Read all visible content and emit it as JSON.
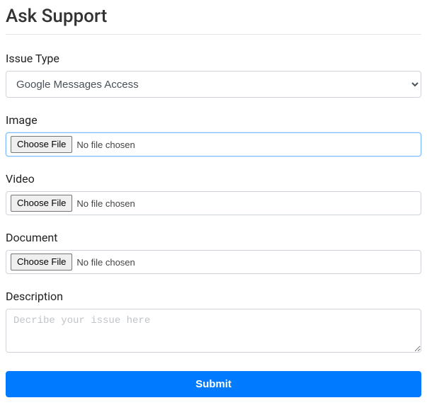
{
  "title": "Ask Support",
  "fields": {
    "issueType": {
      "label": "Issue Type",
      "value": "Google Messages Access"
    },
    "image": {
      "label": "Image",
      "button": "Choose File",
      "status": "No file chosen"
    },
    "video": {
      "label": "Video",
      "button": "Choose File",
      "status": "No file chosen"
    },
    "document": {
      "label": "Document",
      "button": "Choose File",
      "status": "No file chosen"
    },
    "description": {
      "label": "Description",
      "placeholder": "Decribe your issue here"
    }
  },
  "submit": "Submit"
}
